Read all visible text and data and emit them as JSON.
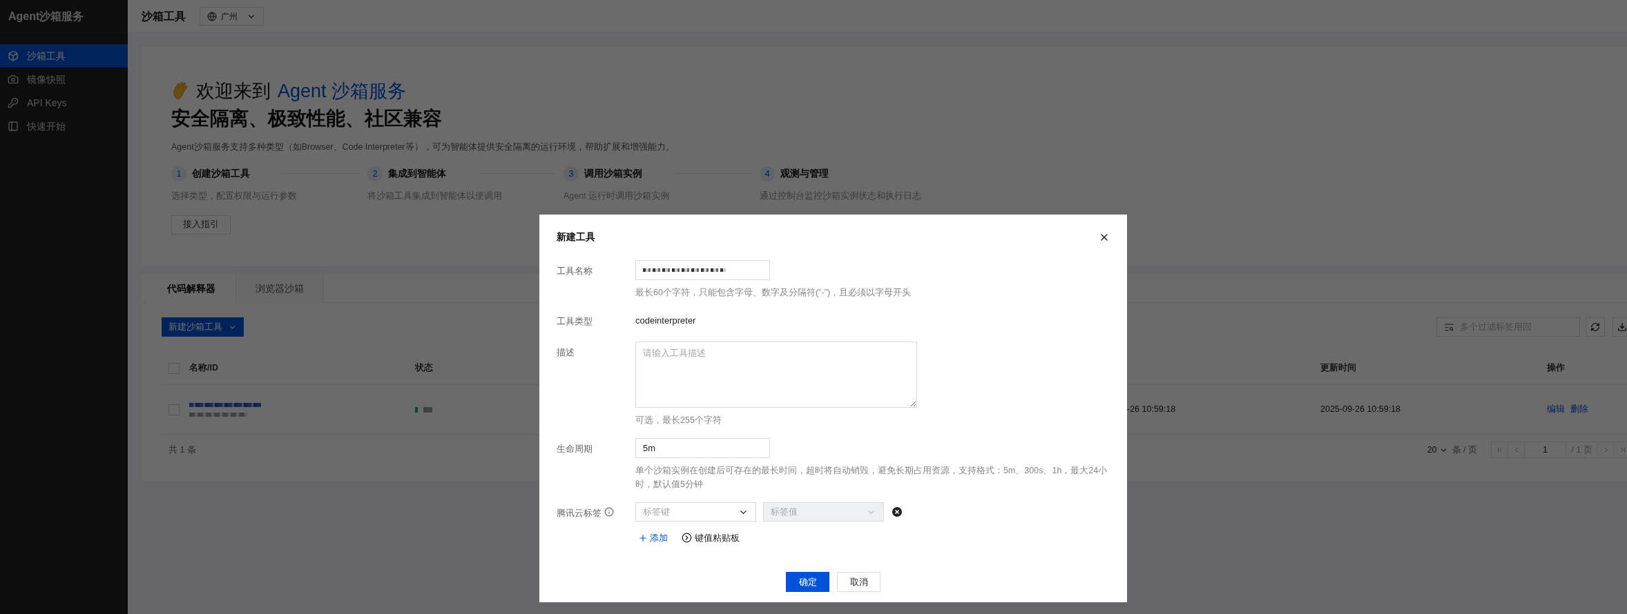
{
  "sidebar": {
    "title": "Agent沙箱服务",
    "items": [
      {
        "label": "沙箱工具",
        "selected": true
      },
      {
        "label": "镜像快照",
        "selected": false
      },
      {
        "label": "API Keys",
        "selected": false
      },
      {
        "label": "快速开始",
        "selected": false
      }
    ]
  },
  "topbar": {
    "title": "沙箱工具",
    "region": "广州"
  },
  "hero": {
    "greeting": "欢迎来到",
    "brand": "Agent 沙箱服务",
    "headline": "安全隔离、极致性能、社区兼容",
    "description": "Agent沙箱服务支持多种类型（如Browser、Code Interpreter等），可为智能体提供安全隔离的运行环境，帮助扩展和增强能力。",
    "steps": [
      {
        "number": "1",
        "title": "创建沙箱工具",
        "description": "选择类型，配置权限与运行参数"
      },
      {
        "number": "2",
        "title": "集成到智能体",
        "description": "将沙箱工具集成到智能体以便调用"
      },
      {
        "number": "3",
        "title": "调用沙箱实例",
        "description": "Agent 运行时调用沙箱实例"
      },
      {
        "number": "4",
        "title": "观测与管理",
        "description": "通过控制台监控沙箱实例状态和执行日志"
      }
    ],
    "guide_button": "接入指引"
  },
  "tabs": [
    {
      "label": "代码解释器",
      "selected": true
    },
    {
      "label": "浏览器沙箱",
      "selected": false
    }
  ],
  "toolbar": {
    "create_button": "新建沙箱工具",
    "search": {
      "placeholder": "多个过滤标签用回"
    }
  },
  "table": {
    "select_all": {
      "checked": false
    },
    "columns": {
      "name_id": "名称/ID",
      "status": "状态",
      "updated": "更新时间",
      "actions": "操作"
    },
    "rows": [
      {
        "checked": false,
        "column_3": "-26 10:59:18",
        "updated": "2025-09-26 10:59:18",
        "actions": [
          "编辑",
          "删除"
        ]
      }
    ]
  },
  "pagination": {
    "total": "共 1 条",
    "page_size": "20",
    "page_size_unit": "条 / 页",
    "page": "1",
    "page_count": "/ 1 页"
  },
  "dialog": {
    "title": "新建工具",
    "fields": [
      {
        "kind": "input",
        "label": "工具名称",
        "hint": "最长60个字符，只能包含字母、数字及分隔符(\"-\")，且必须以字母开头"
      },
      {
        "kind": "static",
        "label": "工具类型",
        "value": "codeinterpreter"
      },
      {
        "kind": "textarea",
        "label": "描述",
        "placeholder": "请输入工具描述",
        "hint": "可选，最长255个字符"
      },
      {
        "kind": "input",
        "label": "生命周期",
        "value": "5m",
        "hint": "单个沙箱实例在创建后可存在的最长时间，超时将自动销毁，避免长期占用资源，支持格式：5m、300s、1h，最大24小时，默认值5分钟"
      },
      {
        "kind": "tags",
        "label": "腾讯云标签",
        "key_placeholder": "标签键",
        "value_placeholder": "标签值",
        "value_disabled": true,
        "add_link": "添加",
        "paste_link": "键值粘贴板"
      }
    ],
    "buttons": [
      {
        "label": "确定",
        "kind": "primary"
      },
      {
        "label": "取消",
        "kind": "secondary"
      }
    ]
  }
}
